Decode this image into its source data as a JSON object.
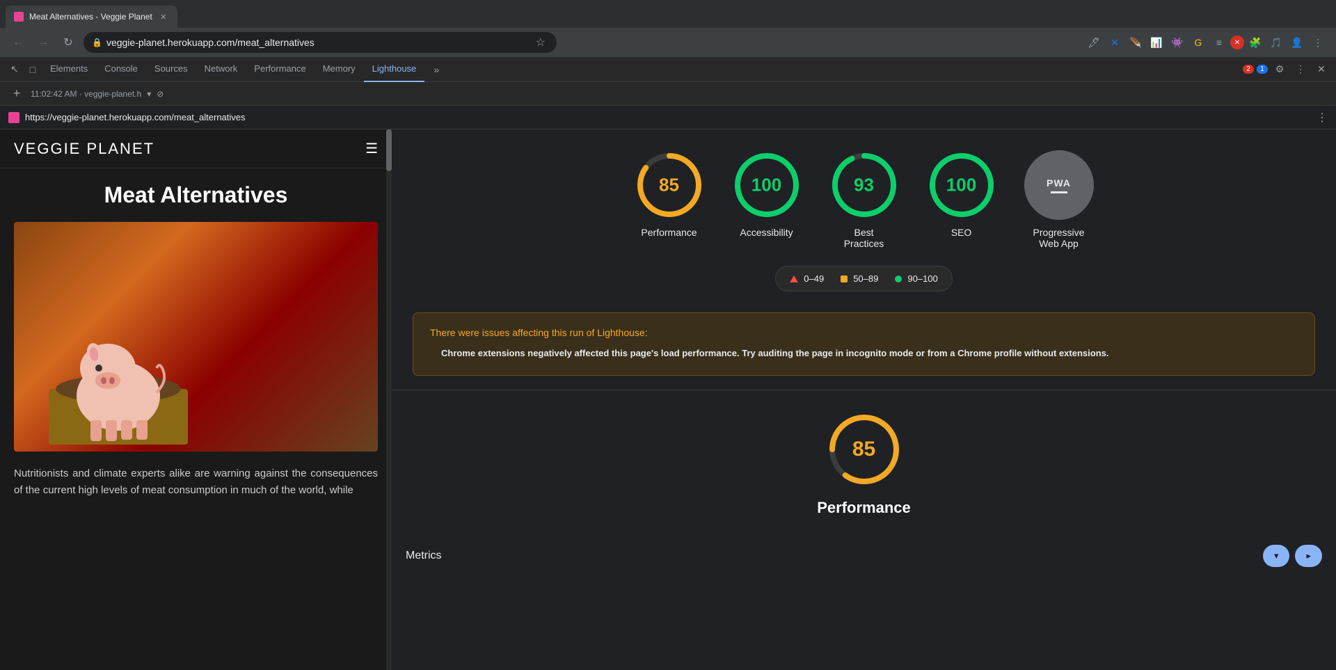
{
  "browser": {
    "tab": {
      "title": "Meat Alternatives - Veggie Planet",
      "url": "veggie-planet.herokuapp.com/meat_alternatives"
    },
    "nav": {
      "back": "←",
      "forward": "→",
      "reload": "↻"
    }
  },
  "devtools": {
    "tabs": [
      "Elements",
      "Console",
      "Sources",
      "Network",
      "Performance",
      "Memory",
      "Lighthouse"
    ],
    "active_tab": "Lighthouse",
    "session": "11:02:42 AM · veggie-planet.h",
    "page_url": "https://veggie-planet.herokuapp.com/meat_alternatives",
    "badge_red": "2",
    "badge_blue": "1"
  },
  "website": {
    "logo": "VEGGIE PLANET",
    "page_title": "Meat Alternatives",
    "paragraph": "Nutritionists and climate experts alike are warning against the consequences of the current high levels of meat consumption in much of the world, while"
  },
  "lighthouse": {
    "scores": [
      {
        "id": "performance",
        "value": 85,
        "label": "Performance",
        "color": "orange",
        "percentage": 85
      },
      {
        "id": "accessibility",
        "value": 100,
        "label": "Accessibility",
        "color": "green",
        "percentage": 100
      },
      {
        "id": "best-practices",
        "value": 93,
        "label": "Best Practices",
        "color": "green",
        "percentage": 93
      },
      {
        "id": "seo",
        "value": 100,
        "label": "SEO",
        "color": "green",
        "percentage": 100
      }
    ],
    "pwa_label": "PWA",
    "legend": [
      {
        "type": "triangle",
        "range": "0–49"
      },
      {
        "type": "square-orange",
        "range": "50–89"
      },
      {
        "type": "circle-green",
        "range": "90–100"
      }
    ],
    "warning": {
      "title": "There were issues affecting this run of Lighthouse:",
      "body": "Chrome extensions negatively affected this page's load performance. Try auditing the page in incognito mode or from a Chrome profile without extensions."
    },
    "bottom_score": {
      "value": 85,
      "label": "Performance",
      "percentage": 85
    },
    "metrics_label": "Metrics",
    "expand_btn": "▾",
    "collapse_btn": "▴"
  }
}
